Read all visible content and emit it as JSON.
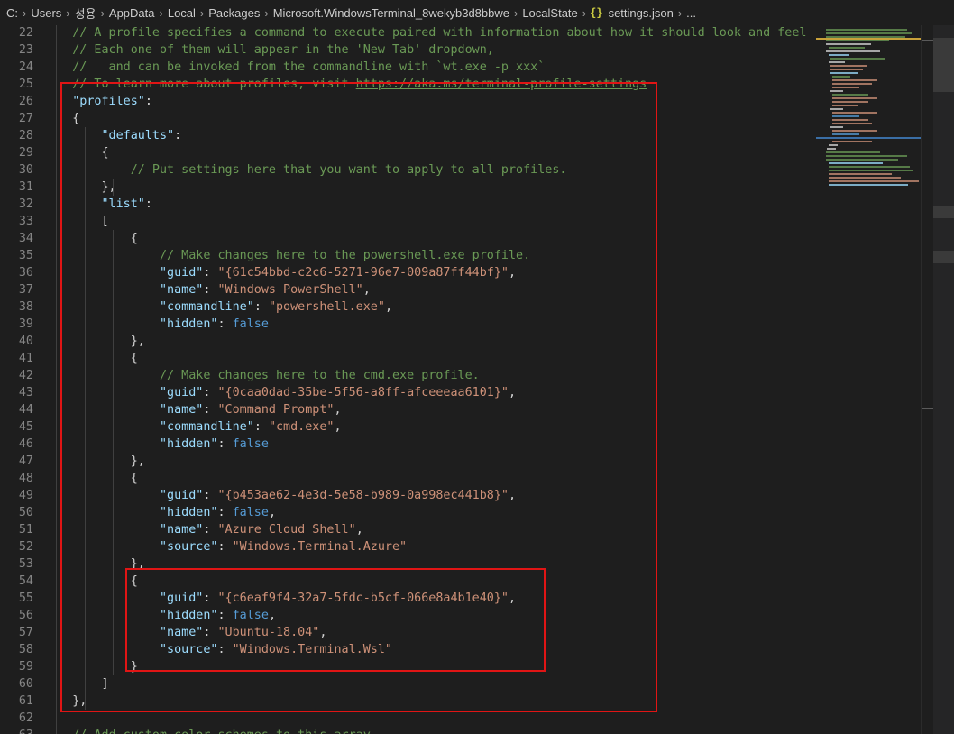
{
  "breadcrumb": {
    "items": [
      "C:",
      "Users",
      "성용",
      "AppData",
      "Local",
      "Packages",
      "Microsoft.WindowsTerminal_8wekyb3d8bbwe",
      "LocalState"
    ],
    "file_icon": "{}",
    "file": "settings.json",
    "tail": "..."
  },
  "editor": {
    "lines": [
      {
        "n": "22",
        "text": "    // A profile specifies a command to execute paired with information about how it should look and feel"
      },
      {
        "n": "23",
        "text": "    // Each one of them will appear in the 'New Tab' dropdown,"
      },
      {
        "n": "24",
        "text": "    //   and can be invoked from the commandline with `wt.exe -p xxx`"
      },
      {
        "n": "25",
        "text": "    // To learn more about profiles, visit https://aka.ms/terminal-profile-settings"
      },
      {
        "n": "26",
        "text": "    \"profiles\":"
      },
      {
        "n": "27",
        "text": "    {"
      },
      {
        "n": "28",
        "text": "        \"defaults\":"
      },
      {
        "n": "29",
        "text": "        {"
      },
      {
        "n": "30",
        "text": "            // Put settings here that you want to apply to all profiles."
      },
      {
        "n": "31",
        "text": "        },"
      },
      {
        "n": "32",
        "text": "        \"list\":"
      },
      {
        "n": "33",
        "text": "        ["
      },
      {
        "n": "34",
        "text": "            {"
      },
      {
        "n": "35",
        "text": "                // Make changes here to the powershell.exe profile."
      },
      {
        "n": "36",
        "text": "                \"guid\": \"{61c54bbd-c2c6-5271-96e7-009a87ff44bf}\","
      },
      {
        "n": "37",
        "text": "                \"name\": \"Windows PowerShell\","
      },
      {
        "n": "38",
        "text": "                \"commandline\": \"powershell.exe\","
      },
      {
        "n": "39",
        "text": "                \"hidden\": false"
      },
      {
        "n": "40",
        "text": "            },"
      },
      {
        "n": "41",
        "text": "            {"
      },
      {
        "n": "42",
        "text": "                // Make changes here to the cmd.exe profile."
      },
      {
        "n": "43",
        "text": "                \"guid\": \"{0caa0dad-35be-5f56-a8ff-afceeeaa6101}\","
      },
      {
        "n": "44",
        "text": "                \"name\": \"Command Prompt\","
      },
      {
        "n": "45",
        "text": "                \"commandline\": \"cmd.exe\","
      },
      {
        "n": "46",
        "text": "                \"hidden\": false"
      },
      {
        "n": "47",
        "text": "            },"
      },
      {
        "n": "48",
        "text": "            {"
      },
      {
        "n": "49",
        "text": "                \"guid\": \"{b453ae62-4e3d-5e58-b989-0a998ec441b8}\","
      },
      {
        "n": "50",
        "text": "                \"hidden\": false,"
      },
      {
        "n": "51",
        "text": "                \"name\": \"Azure Cloud Shell\","
      },
      {
        "n": "52",
        "text": "                \"source\": \"Windows.Terminal.Azure\""
      },
      {
        "n": "53",
        "text": "            },"
      },
      {
        "n": "54",
        "text": "            {"
      },
      {
        "n": "55",
        "text": "                \"guid\": \"{c6eaf9f4-32a7-5fdc-b5cf-066e8a4b1e40}\","
      },
      {
        "n": "56",
        "text": "                \"hidden\": false,"
      },
      {
        "n": "57",
        "text": "                \"name\": \"Ubuntu-18.04\","
      },
      {
        "n": "58",
        "text": "                \"source\": \"Windows.Terminal.Wsl\""
      },
      {
        "n": "59",
        "text": "            }"
      },
      {
        "n": "60",
        "text": "        ]"
      },
      {
        "n": "61",
        "text": "    },"
      },
      {
        "n": "62",
        "text": ""
      },
      {
        "n": "63",
        "text": "    // Add custom color schemes to this array."
      }
    ]
  },
  "colors": {
    "background": "#1e1e1e",
    "comment": "#6a9955",
    "key": "#9cdcfe",
    "string": "#ce9178",
    "keyword": "#569cd6",
    "punctuation": "#d4d4d4",
    "line_number": "#858585",
    "highlight_box": "#e01515"
  },
  "icons": {
    "breadcrumb_separator": "chevron-right-icon",
    "file_type": "json-braces-icon"
  }
}
